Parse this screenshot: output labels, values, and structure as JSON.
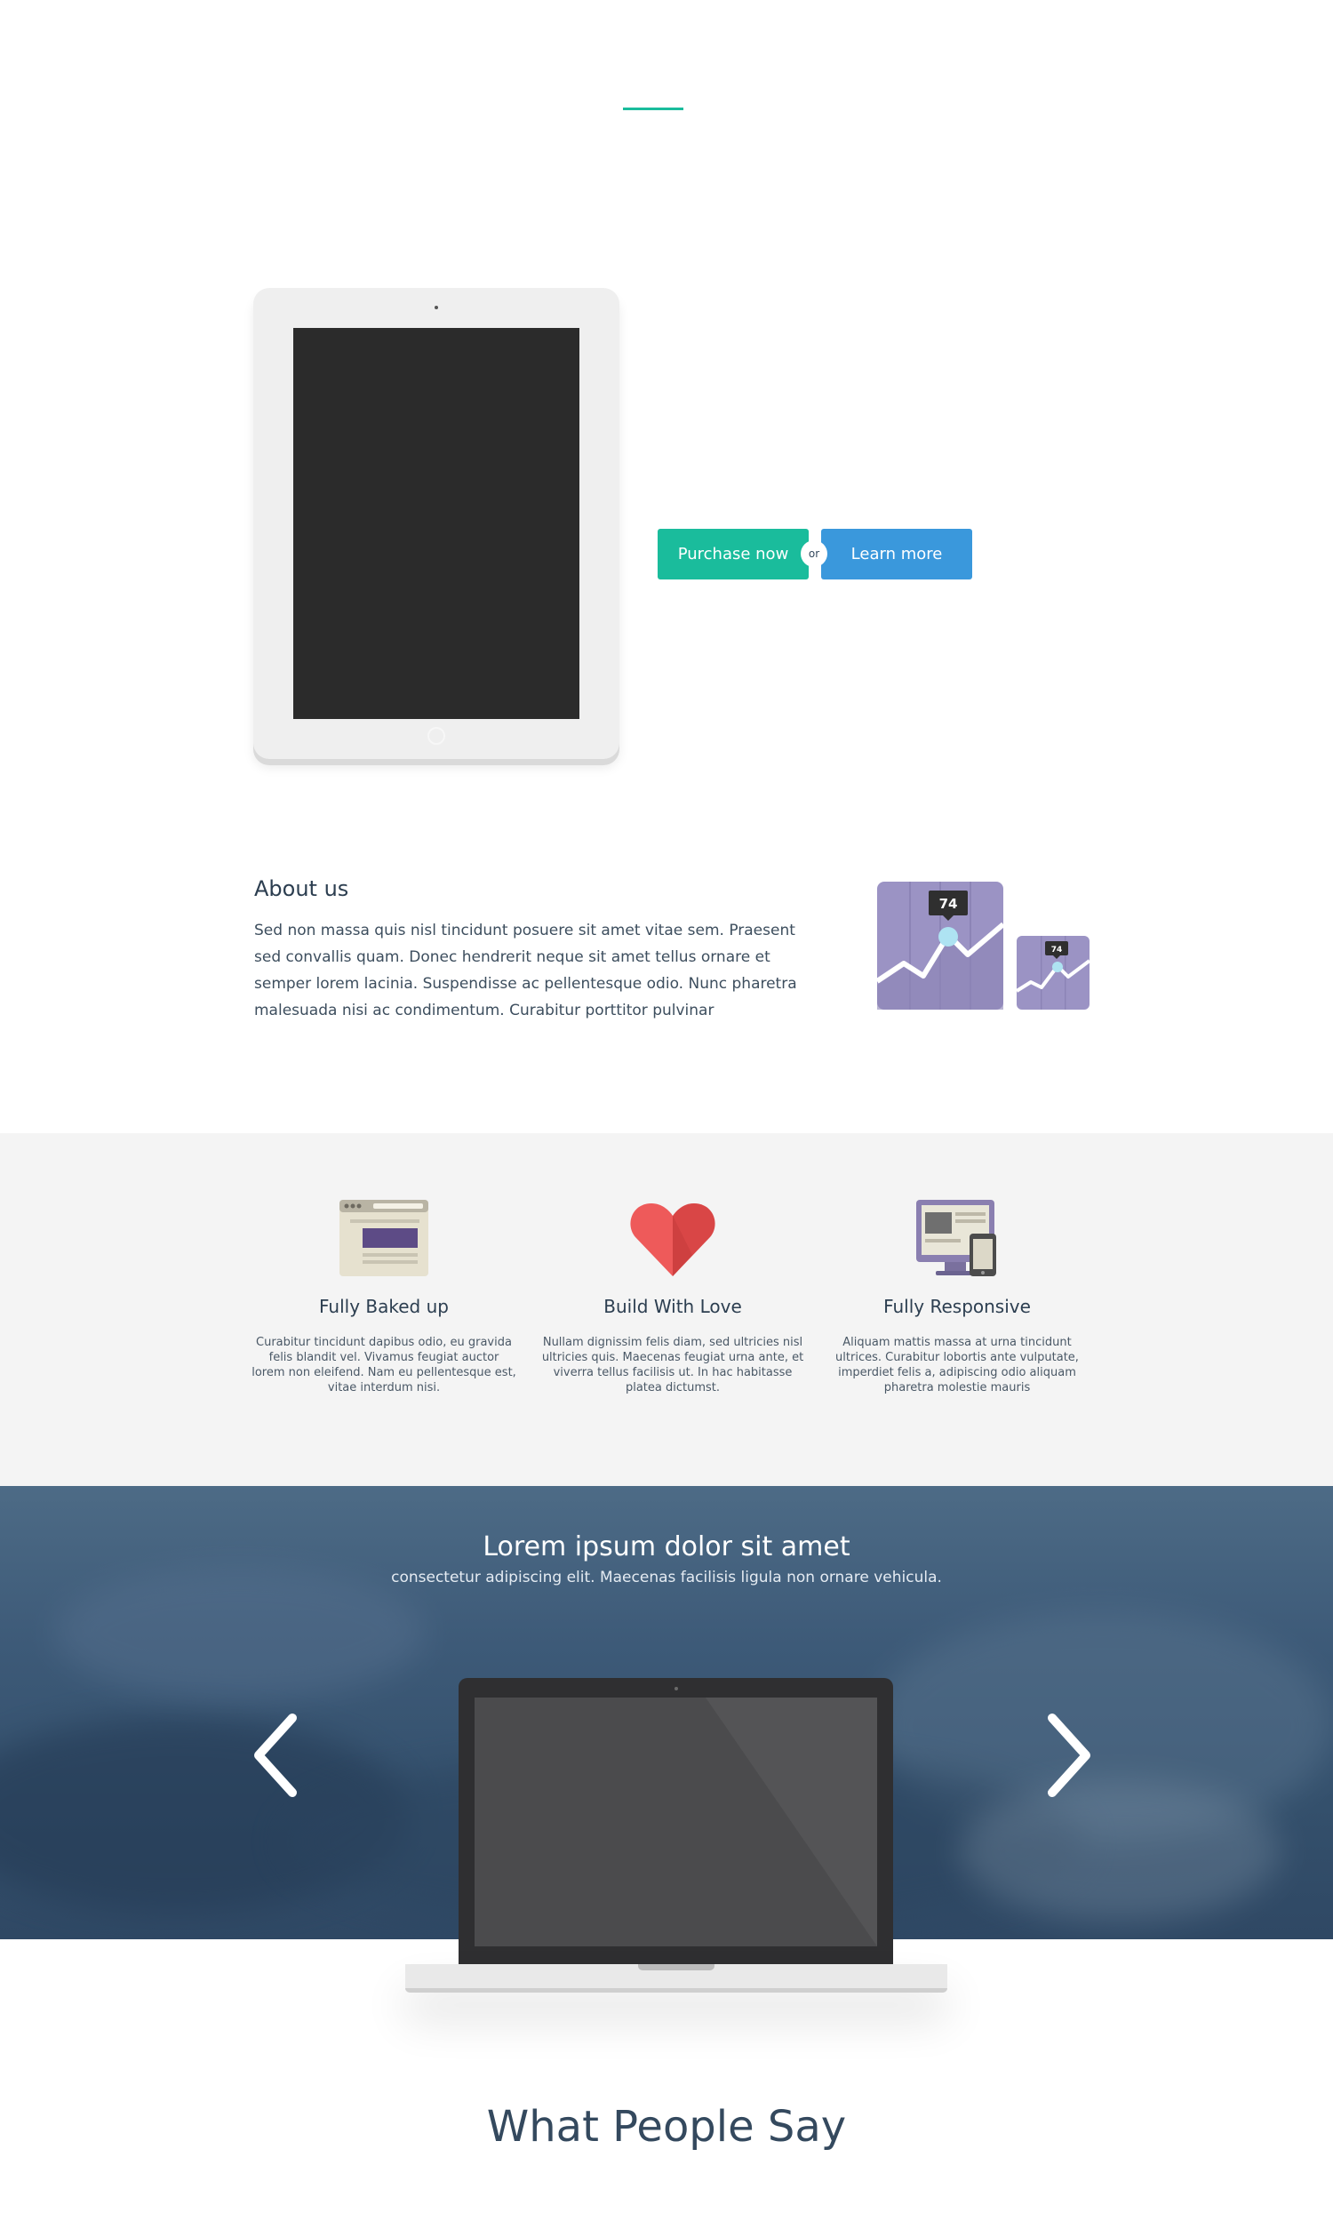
{
  "colors": {
    "accent_green": "#1abc9c",
    "accent_blue": "#3a98dc",
    "text_dark": "#34495e",
    "features_bg": "#f4f4f4"
  },
  "cta": {
    "purchase_label": "Purchase now",
    "or_label": "or",
    "learn_label": "Learn more"
  },
  "about": {
    "title": "About us",
    "text": "Sed non massa quis nisl tincidunt posuere sit amet vitae sem. Praesent sed convallis quam. Donec hendrerit neque sit amet tellus ornare et semper lorem lacinia. Suspendisse ac pellentesque odio. Nunc pharetra malesuada nisi ac condimentum. Curabitur porttitor pulvinar",
    "chart_badge_big": "74",
    "chart_badge_small": "74"
  },
  "features": [
    {
      "icon": "browser-window-icon",
      "title": "Fully Baked up",
      "text": "Curabitur tincidunt dapibus odio, eu gravida felis blandit vel. Vivamus feugiat auctor lorem non eleifend. Nam eu pellentesque est, vitae interdum nisi."
    },
    {
      "icon": "heart-icon",
      "title": "Build With Love",
      "text": "Nullam dignissim felis diam, sed ultricies nisl ultricies quis. Maecenas feugiat urna ante, et viverra tellus facilisis ut. In hac habitasse platea dictumst."
    },
    {
      "icon": "responsive-devices-icon",
      "title": "Fully Responsive",
      "text": "Aliquam mattis massa at urna tincidunt ultrices. Curabitur lobortis ante vulputate, imperdiet felis a, adipiscing odio aliquam pharetra molestie mauris"
    }
  ],
  "hero": {
    "title": "Lorem ipsum dolor sit amet",
    "subtitle": "consectetur adipiscing elit. Maecenas facilisis ligula non ornare vehicula.",
    "prev_icon": "chevron-left-icon",
    "next_icon": "chevron-right-icon"
  },
  "testimonials": {
    "title": "What People Say"
  }
}
